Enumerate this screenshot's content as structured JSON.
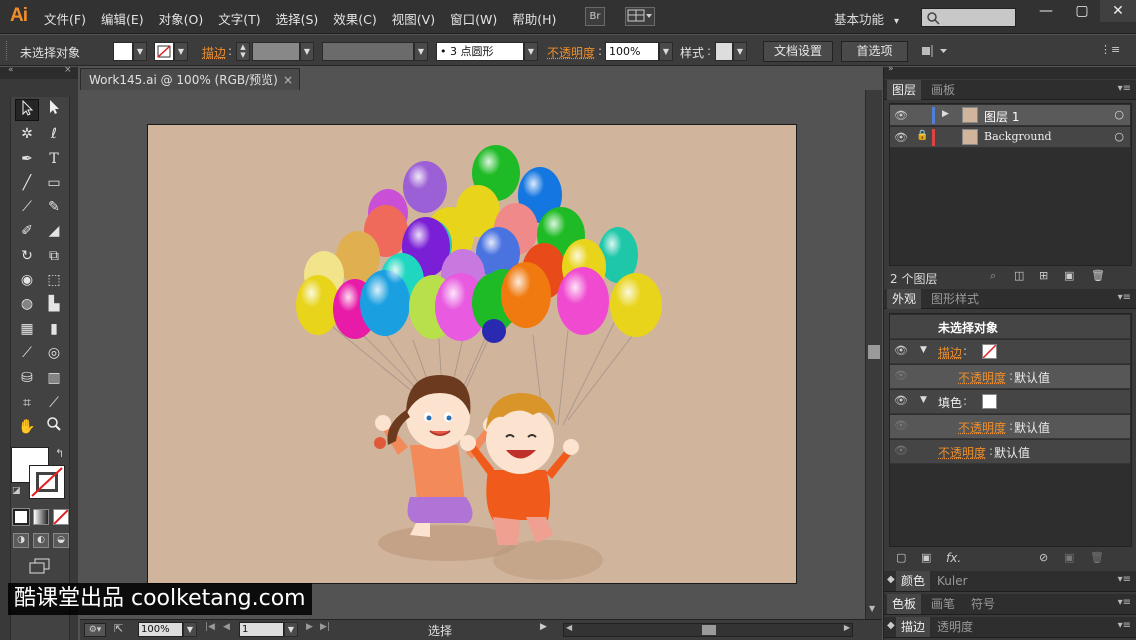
{
  "app": {
    "logo": "Ai"
  },
  "menu": {
    "items": [
      "文件(F)",
      "编辑(E)",
      "对象(O)",
      "文字(T)",
      "选择(S)",
      "效果(C)",
      "视图(V)",
      "窗口(W)",
      "帮助(H)"
    ]
  },
  "menubar": {
    "bridge": "Br",
    "workspace": "基本功能",
    "workspace_arrow": "▾"
  },
  "control": {
    "selection_status": "未选择对象",
    "stroke_label": "描边",
    "brush_label": "3 点圆形",
    "opacity_label": "不透明度",
    "opacity_value": "100%",
    "style_label": "样式",
    "doc_setup": "文档设置",
    "preferences": "首选项"
  },
  "document": {
    "tab_title": "Work145.ai @ 100% (RGB/预览)",
    "close_glyph": "×"
  },
  "status": {
    "zoom": "100%",
    "page": "1",
    "tool": "选择"
  },
  "layers_panel": {
    "tabs": [
      "图层",
      "画板"
    ],
    "layers": [
      {
        "name": "图层 1",
        "color": "#4f7fd9",
        "selected": true,
        "locked": false
      },
      {
        "name": "Background",
        "color": "#e04343",
        "selected": false,
        "locked": true
      }
    ],
    "count": "2 个图层"
  },
  "appearance_panel": {
    "tabs": [
      "外观",
      "图形样式"
    ],
    "header": "未选择对象",
    "stroke_label": "描边",
    "fill_label": "填色",
    "opacity_label": "不透明度",
    "opacity_default": "默认值",
    "fx_label": "fx."
  },
  "bottom_panels": {
    "row1": [
      "颜色",
      "Kuler"
    ],
    "row2": [
      "色板",
      "画笔",
      "符号"
    ],
    "row3": [
      "描边",
      "透明度"
    ]
  },
  "watermark": "酷课堂出品 coolketang.com",
  "colors": {
    "accent": "#ef8e2a",
    "artboard": "#d1b49c"
  }
}
